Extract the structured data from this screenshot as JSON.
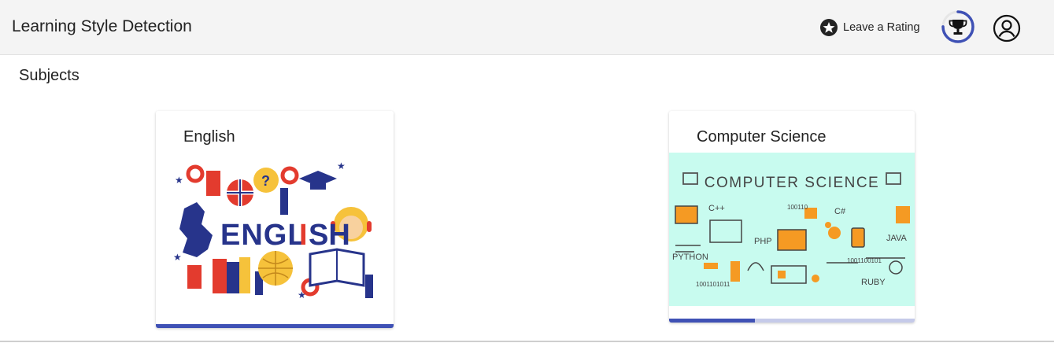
{
  "app": {
    "title": "Learning Style Detection"
  },
  "header": {
    "rating_label": "Leave a Rating",
    "rating_icon": "star-circle-icon",
    "trophy_icon": "trophy-icon",
    "account_icon": "account-circle-icon",
    "trophy_progress": 0.75
  },
  "section": {
    "title": "Subjects"
  },
  "subjects": [
    {
      "name": "English",
      "image_word": "ENGLISH",
      "progress": 1.0,
      "progress_track_color": "#3f51b5"
    },
    {
      "name": "Computer Science",
      "image_heading": "COMPUTER SCIENCE",
      "image_labels": [
        "C++",
        "C#",
        "PHP",
        "JAVA",
        "PYTHON",
        "RUBY",
        "100110",
        "1001101011",
        "1001100101"
      ],
      "progress": 0.35,
      "progress_track_color": "#c5cae9"
    }
  ],
  "colors": {
    "accent": "#3f51b5",
    "accent_light": "#c5cae9",
    "topbar": "#f4f4f4",
    "cs_background": "#c8fbef",
    "cs_orange": "#f59a23",
    "english_blue": "#27348b",
    "english_red": "#e33b2e",
    "english_yellow": "#f6c23b"
  }
}
